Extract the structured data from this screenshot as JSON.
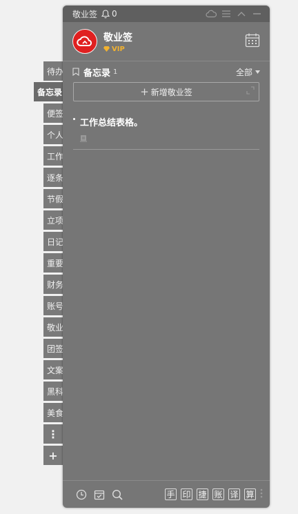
{
  "side_tabs": [
    "待办",
    "备忘录",
    "便签",
    "个人",
    "工作",
    "逐条",
    "节假",
    "立项",
    "日记",
    "重要",
    "财务",
    "账号",
    "敬业",
    "团签",
    "文案",
    "黑科",
    "美食"
  ],
  "active_tab_index": 1,
  "tab_more_label": "⋮",
  "tab_add_label": "+",
  "titlebar": {
    "title": "敬业签",
    "notification_count": "0"
  },
  "user": {
    "name": "敬业签",
    "vip_label": "VIP"
  },
  "section": {
    "title": "备忘录",
    "count": "1",
    "filter_label": "全部"
  },
  "add_button_label": "新增敬业签",
  "notes": [
    {
      "text": "工作总结表格。"
    }
  ],
  "footer": {
    "quick_buttons": [
      "手",
      "印",
      "捷",
      "账",
      "译",
      "算"
    ]
  },
  "colors": {
    "panel": "#767676",
    "titlebar": "#5f5f5f",
    "avatar": "#e02020",
    "vip": "#f2b230"
  }
}
